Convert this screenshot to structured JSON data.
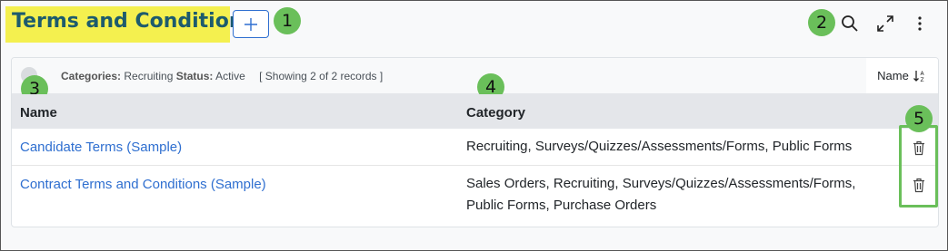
{
  "header": {
    "title": "Terms and Conditions",
    "add_button_label": "+"
  },
  "annotations": [
    "1",
    "2",
    "3",
    "4",
    "5"
  ],
  "toolbar": {
    "icons": [
      "search-icon",
      "expand-icon",
      "more-vertical-icon"
    ]
  },
  "filter_bar": {
    "categories_label": "Categories:",
    "categories_value": "Recruiting",
    "status_label": "Status:",
    "status_value": "Active",
    "showing_text": "[ Showing 2 of 2 records ]",
    "sort_label": "Name"
  },
  "table": {
    "columns": [
      "Name",
      "Category"
    ],
    "rows": [
      {
        "name": "Candidate Terms (Sample)",
        "category": "Recruiting, Surveys/Quizzes/Assessments/Forms, Public Forms"
      },
      {
        "name": "Contract Terms and Conditions (Sample)",
        "category": "Sales Orders, Recruiting, Surveys/Quizzes/Assessments/Forms, Public Forms, Purchase Orders"
      }
    ]
  },
  "colors": {
    "title": "#1d5b6d",
    "highlight": "#f4f04f",
    "link": "#2f6fd0",
    "badge": "#6abf5a"
  }
}
